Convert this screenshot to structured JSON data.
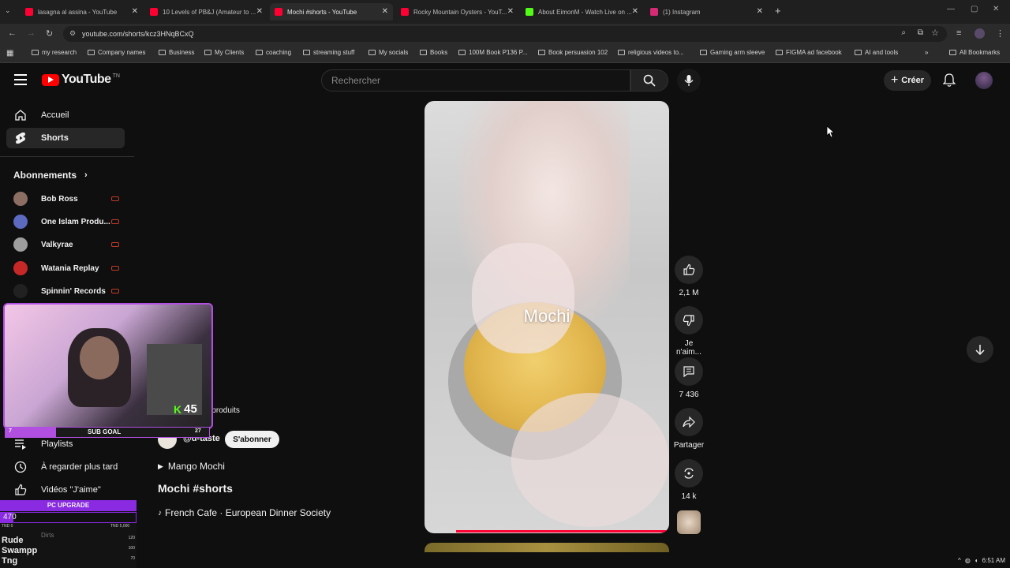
{
  "browser": {
    "tabs": [
      {
        "title": "lasagna al assina - YouTube",
        "color": "#ff0033"
      },
      {
        "title": "10 Levels of PB&J (Amateur to ...",
        "color": "#ff0033"
      },
      {
        "title": "Mochi #shorts - YouTube",
        "color": "#ff0033"
      },
      {
        "title": "Rocky Mountain Oysters - YouT...",
        "color": "#ff0033"
      },
      {
        "title": "About EimonM - Watch Live on ...",
        "color": "#53fc18"
      },
      {
        "title": "(1) Instagram",
        "color": "#d62976"
      }
    ],
    "url": "youtube.com/shorts/kcz3HNqBCxQ",
    "bookmarks": [
      "my research",
      "Company names",
      "Business",
      "My Clients",
      "coaching",
      "streaming stuff",
      "My socials",
      "Books",
      "100M Book P136 P...",
      "Book persuasion 102",
      "religious videos to...",
      "Gaming arm sleeve",
      "FIGMA ad facebook",
      "AI and tools"
    ],
    "all_bookmarks": "All Bookmarks"
  },
  "yt": {
    "logo_text": "YouTube",
    "country": "TN",
    "search_placeholder": "Rechercher",
    "create_label": "Créer"
  },
  "sidebar": {
    "home": "Accueil",
    "shorts": "Shorts",
    "subscriptions_title": "Abonnements",
    "subs": [
      {
        "name": "Bob Ross",
        "color": "#8d6e63"
      },
      {
        "name": "One Islam Produ...",
        "color": "#5c6bc0"
      },
      {
        "name": "Valkyrae",
        "color": "#9e9e9e"
      },
      {
        "name": "Watania Replay",
        "color": "#c62828"
      },
      {
        "name": "Spinnin' Records",
        "color": "#212121"
      }
    ],
    "playlists": "Playlists",
    "watch_later": "À regarder plus tard",
    "liked": "Vidéos \"J'aime\"",
    "below": "Dirts"
  },
  "short": {
    "overlay_text": "Mochi",
    "products_label": "es produits",
    "channel": "@u-taste",
    "subscribe": "S'abonner",
    "playlist_label": "Mango Mochi",
    "title": "Mochi #shorts",
    "music": "French Cafe · European Dinner Society",
    "progress": 1.0
  },
  "actions": {
    "likes": "2,1 M",
    "dislike": "Je n'aim...",
    "comments": "7 436",
    "share": "Partager",
    "remix": "14 k"
  },
  "stream_overlay": {
    "kick_count": "45",
    "sub_goal": "SUB GOAL",
    "sub_left": "7",
    "sub_right": "27",
    "pc_upgrade": "PC UPGRADE",
    "pc_value": "470",
    "pc_min": "TND 0",
    "pc_max": "TND 5,000",
    "leaderboard": [
      {
        "name": "Rude",
        "value": "120"
      },
      {
        "name": "Swampp",
        "value": "100"
      },
      {
        "name": "Tng",
        "value": "70"
      }
    ]
  },
  "system": {
    "time": "6:51 AM"
  }
}
